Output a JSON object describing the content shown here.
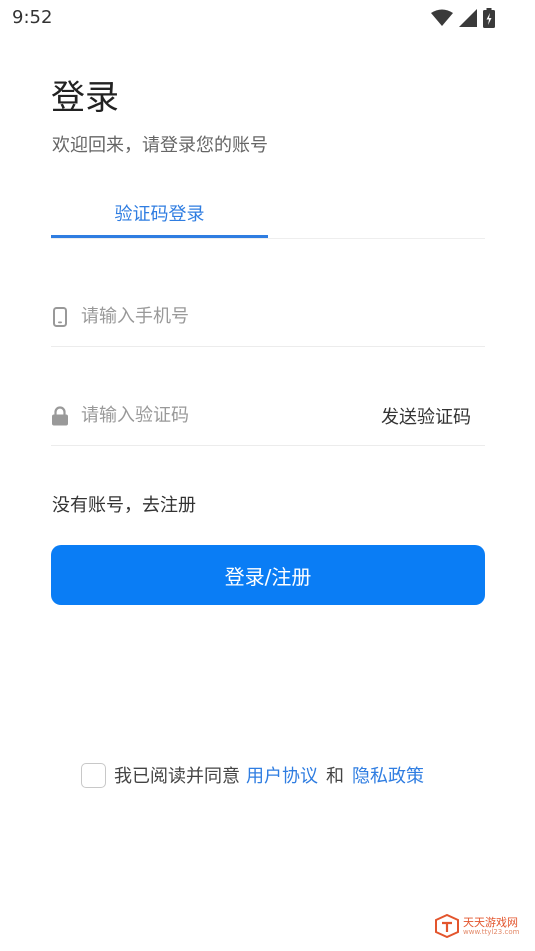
{
  "status_bar": {
    "time": "9:52"
  },
  "header": {
    "title": "登录",
    "subtitle": "欢迎回来，请登录您的账号"
  },
  "tabs": [
    {
      "label": "验证码登录",
      "active": true
    }
  ],
  "form": {
    "phone_placeholder": "请输入手机号",
    "code_placeholder": "请输入验证码",
    "send_code_label": "发送验证码",
    "register_link": "没有账号，去注册",
    "submit_label": "登录/注册"
  },
  "agreement": {
    "checked": false,
    "prefix": "我已阅读并同意",
    "user_agreement": "用户协议",
    "conjunction": "和",
    "privacy_policy": "隐私政策"
  },
  "watermark": {
    "text": "天天游戏网",
    "url": "www.ttyl23.com"
  },
  "colors": {
    "accent": "#2f7de1",
    "button": "#0a7df5",
    "icon": "#999999"
  },
  "icons": [
    "wifi-icon",
    "signal-icon",
    "battery-icon",
    "phone-icon",
    "lock-icon",
    "watermark-logo-icon"
  ]
}
